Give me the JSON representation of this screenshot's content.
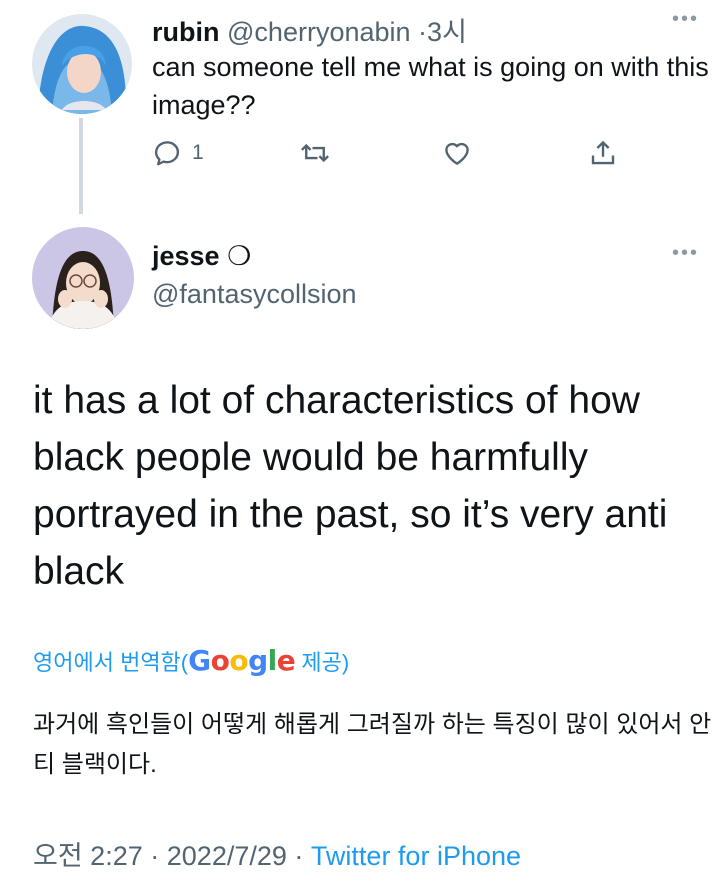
{
  "reply": {
    "name": "rubin",
    "handle": "@cherryonabin",
    "separator": "·",
    "time": "3시",
    "text": "can someone tell me what is going on with this image??",
    "more_icon": "ellipsis-icon",
    "actions": {
      "reply_count": "1",
      "icons": [
        "reply-icon",
        "retweet-icon",
        "like-icon",
        "share-icon"
      ]
    }
  },
  "tweet": {
    "name": "jesse",
    "name_suffix": "❍",
    "handle": "@fantasycollsion",
    "more_icon": "ellipsis-icon",
    "text": "it has a lot of characteristics of how black people would be harmfully portrayed in the past, so it’s very anti black",
    "translate": {
      "prefix": "영어에서 번역함(",
      "google": [
        "G",
        "o",
        "o",
        "g",
        "l",
        "e"
      ],
      "suffix": " 제공)"
    },
    "translated_text": "과거에 흑인들이 어떻게 해롭게 그려질까 하는 특징이 많이 있어서 안티 블랙이다.",
    "time": "오전 2:27",
    "separator": "·",
    "date": "2022/7/29",
    "source": "Twitter for iPhone"
  },
  "colors": {
    "text": "#0f1419",
    "muted": "#536471",
    "link": "#1d9bf0",
    "thread_line": "#cfd9de"
  }
}
